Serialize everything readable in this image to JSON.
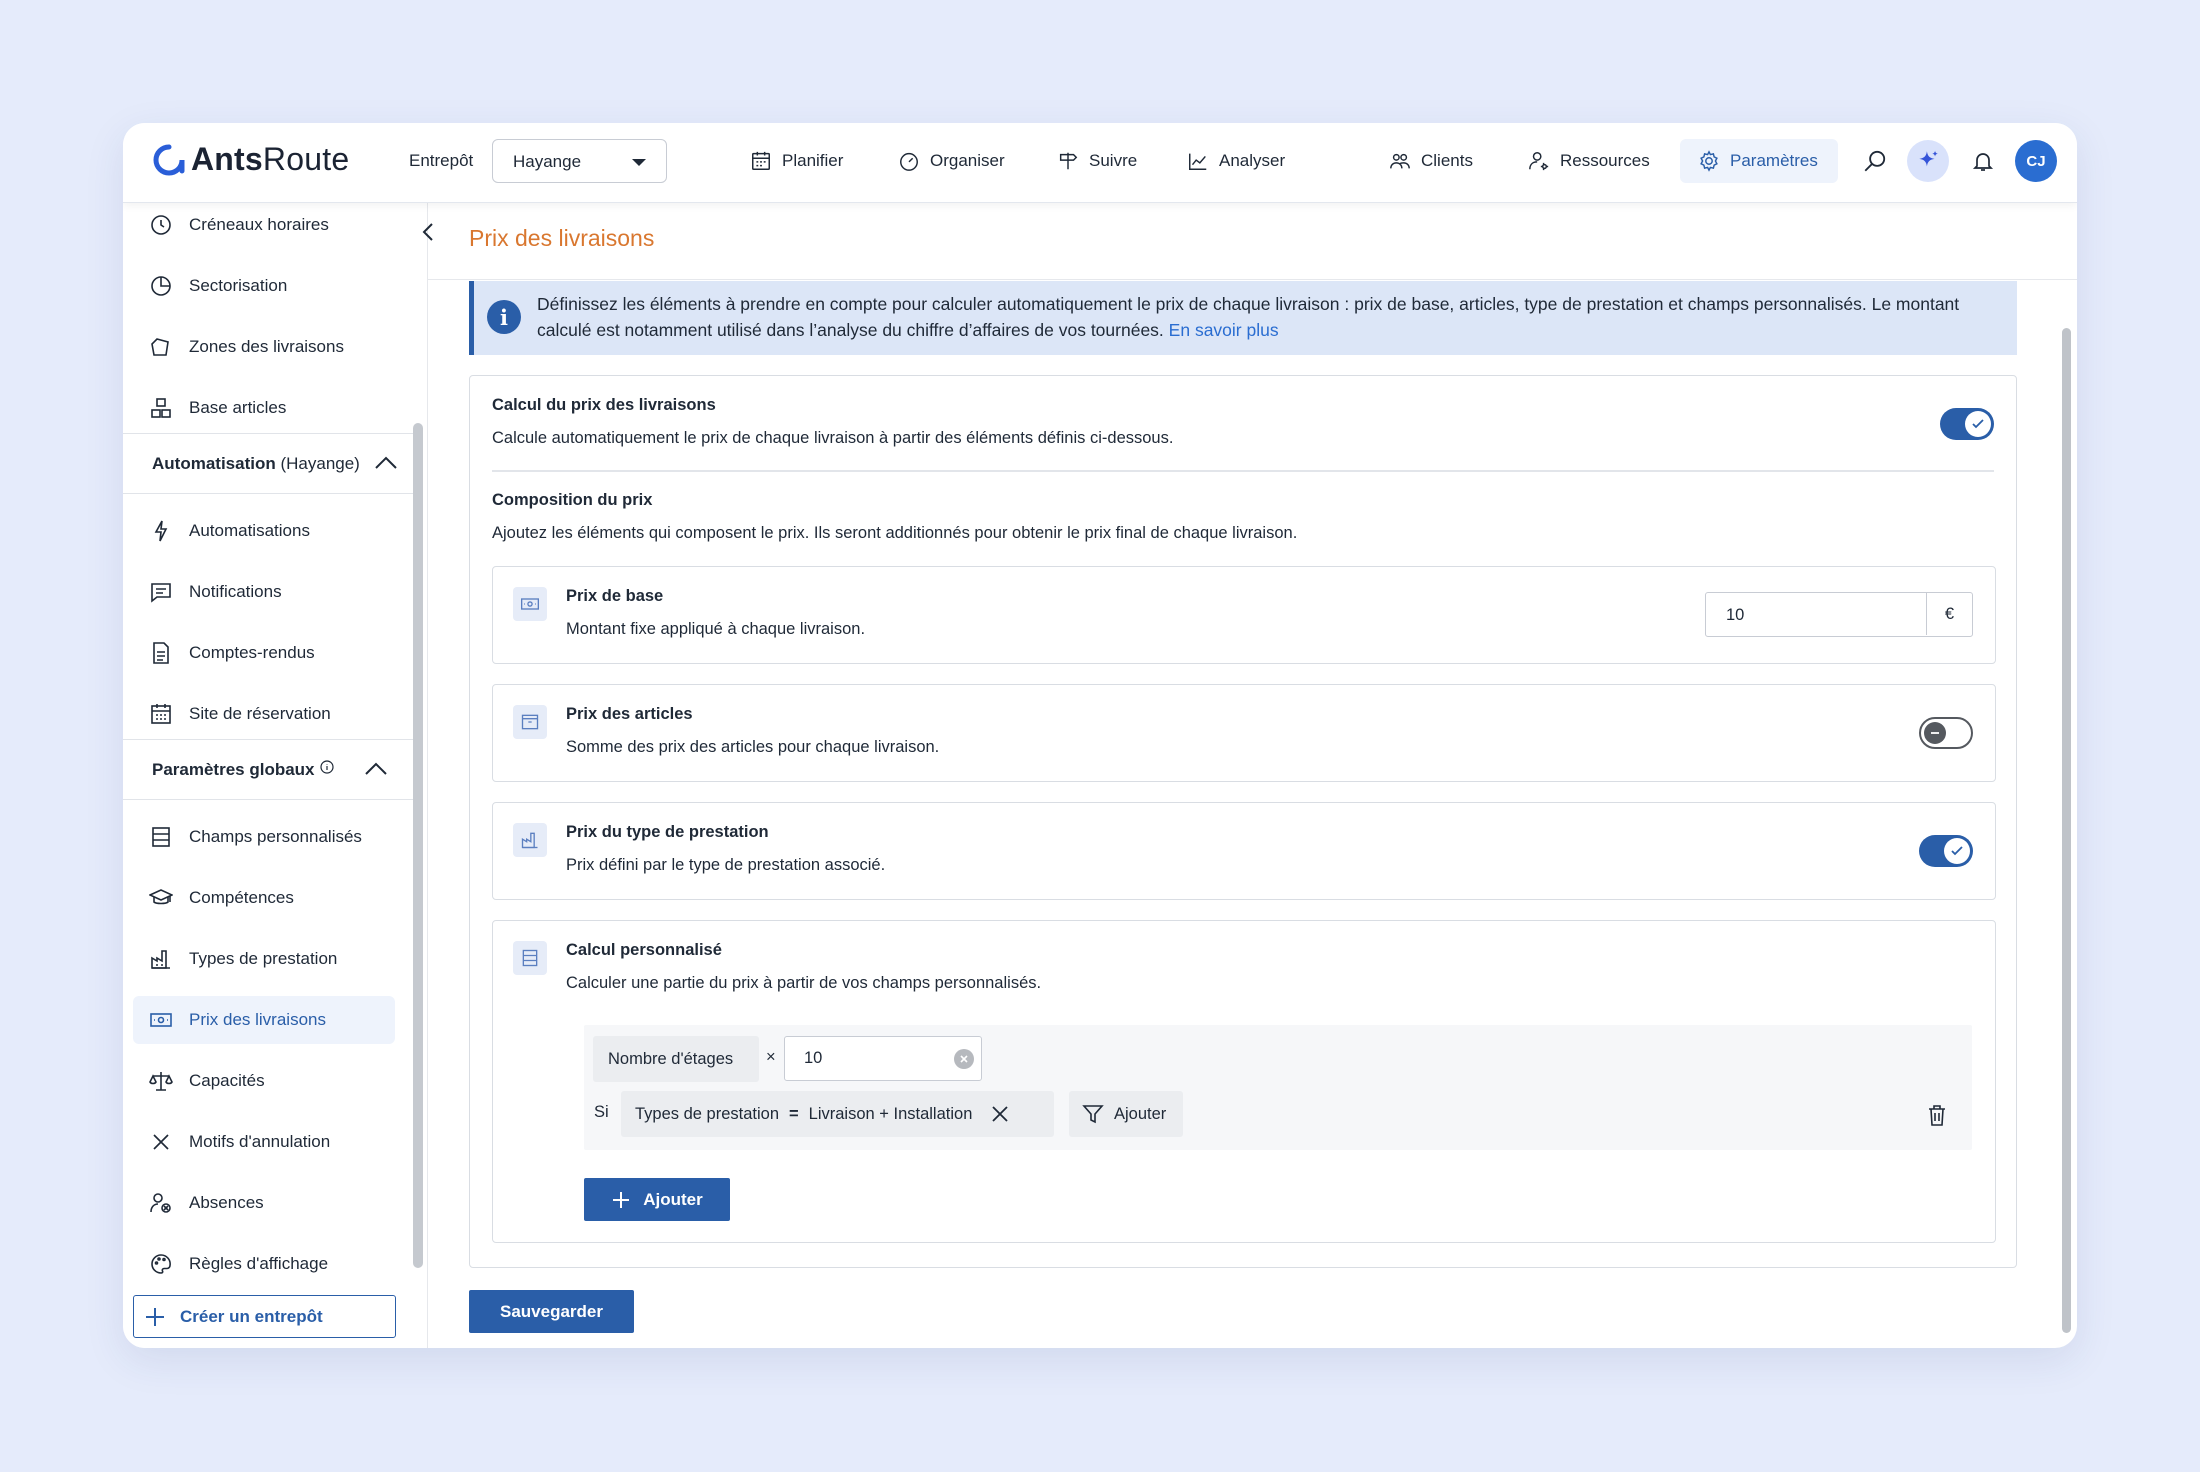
{
  "brand": {
    "name_bold": "Ants",
    "name_rest": "Route"
  },
  "header": {
    "warehouse_label": "Entrepôt",
    "warehouse_value": "Hayange",
    "nav": [
      {
        "label": "Planifier",
        "icon": "calendar-icon"
      },
      {
        "label": "Organiser",
        "icon": "gauge-icon"
      },
      {
        "label": "Suivre",
        "icon": "signpost-icon"
      },
      {
        "label": "Analyser",
        "icon": "chart-icon"
      },
      {
        "label": "Clients",
        "icon": "users-icon"
      },
      {
        "label": "Ressources",
        "icon": "user-gear-icon"
      },
      {
        "label": "Paramètres",
        "icon": "gear-icon",
        "active": true
      }
    ],
    "avatar_initials": "CJ"
  },
  "sidebar": {
    "top_items": [
      {
        "label": "Créneaux horaires",
        "icon": "clock-icon"
      },
      {
        "label": "Sectorisation",
        "icon": "pie-icon"
      },
      {
        "label": "Zones des livraisons",
        "icon": "pentagon-icon"
      },
      {
        "label": "Base articles",
        "icon": "boxes-icon"
      }
    ],
    "section_automation": {
      "label": "Automatisation",
      "suffix": "(Hayange)"
    },
    "automation_items": [
      {
        "label": "Automatisations",
        "icon": "bolt-icon"
      },
      {
        "label": "Notifications",
        "icon": "message-icon"
      },
      {
        "label": "Comptes-rendus",
        "icon": "document-icon"
      },
      {
        "label": "Site de réservation",
        "icon": "calendar-grid-icon"
      }
    ],
    "section_global": {
      "label": "Paramètres globaux"
    },
    "global_items": [
      {
        "label": "Champs personnalisés",
        "icon": "list-icon"
      },
      {
        "label": "Compétences",
        "icon": "graduation-icon"
      },
      {
        "label": "Types de prestation",
        "icon": "factory-icon"
      },
      {
        "label": "Prix des livraisons",
        "icon": "money-icon",
        "active": true
      },
      {
        "label": "Capacités",
        "icon": "scale-icon"
      },
      {
        "label": "Motifs d'annulation",
        "icon": "x-icon"
      },
      {
        "label": "Absences",
        "icon": "user-x-icon"
      },
      {
        "label": "Règles d'affichage",
        "icon": "palette-icon"
      }
    ],
    "create_button": "Créer un entrepôt"
  },
  "page": {
    "title": "Prix des livraisons",
    "info_text": "Définissez les éléments à prendre en compte pour calculer automatiquement le prix de chaque livraison : prix de base, articles, type de prestation et champs personnalisés. Le montant calculé est notamment utilisé dans l’analyse du chiffre d’affaires de vos tournées.",
    "info_link": "En savoir plus",
    "calc": {
      "title": "Calcul du prix des livraisons",
      "desc": "Calcule automatiquement le prix de chaque livraison à partir des éléments définis ci-dessous.",
      "enabled": true
    },
    "composition": {
      "title": "Composition du prix",
      "desc": "Ajoutez les éléments qui composent le prix. Ils seront additionnés pour obtenir le prix final de chaque livraison."
    },
    "base_price": {
      "title": "Prix de base",
      "desc": "Montant fixe appliqué à chaque livraison.",
      "value": "10",
      "unit": "€"
    },
    "articles_price": {
      "title": "Prix des articles",
      "desc": "Somme des prix des articles pour chaque livraison.",
      "enabled": false
    },
    "service_price": {
      "title": "Prix du type de prestation",
      "desc": "Prix défini par le type de prestation associé.",
      "enabled": true
    },
    "custom_calc": {
      "title": "Calcul personnalisé",
      "desc": "Calculer une partie du prix à partir de vos champs personnalisés.",
      "field_chip": "Nombre d'étages",
      "operator": "×",
      "factor_value": "10",
      "condition_prefix": "Si",
      "condition_field": "Types de prestation",
      "condition_operator": "=",
      "condition_value": "Livraison + Installation",
      "filter_add": "Ajouter",
      "add_button": "Ajouter"
    },
    "save_button": "Sauvegarder"
  },
  "colors": {
    "primary": "#2a5ea8",
    "title_accent": "#d9772f",
    "info_bg": "#dce6f7",
    "page_bg": "#e5ebfb"
  }
}
